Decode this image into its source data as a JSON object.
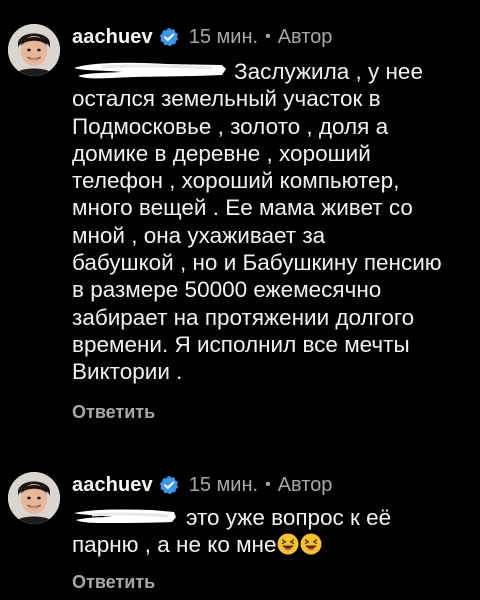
{
  "comments": [
    {
      "username": "aachuev",
      "time": "15 мин.",
      "separator": "•",
      "author_badge": "Автор",
      "text": "Заслужила , у нее\nостался земельный участок в\nПодмосковье , золото , доля а\nдомике в деревне , хороший\nтелефон , хороший компьютер,\nмного вещей . Ее мама живет со\nмной , она ухаживает за\nбабушкой , но и Бабушкину пенсию\nв размере 50000 ежемесячно\nзабирает на протяжении долгого\nвремени. Я исполнил все мечты\nВиктории .",
      "reply_label": "Ответить",
      "avatar_icon": "avatar-photo",
      "verified_icon": "verified-badge-icon",
      "verified_color": "#3897f0"
    },
    {
      "username": "aachuev",
      "time": "15 мин.",
      "separator": "•",
      "author_badge": "Автор",
      "text": "это уже вопрос к её\nпарню , а не ко мне",
      "emoji": "😆😆",
      "reply_label": "Ответить",
      "avatar_icon": "avatar-photo",
      "verified_icon": "verified-badge-icon",
      "verified_color": "#3897f0"
    }
  ],
  "colors": {
    "background": "#000000",
    "primary_text": "#f2f2f2",
    "secondary_text": "#a8a8a8",
    "accent": "#3897f0"
  }
}
